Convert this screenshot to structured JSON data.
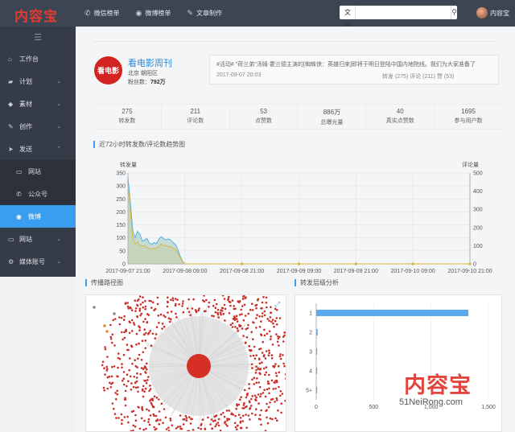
{
  "app": {
    "logo_text": "内容宝"
  },
  "topnav": [
    {
      "label": "微信榜单",
      "icon": "wechat-icon"
    },
    {
      "label": "微博榜单",
      "icon": "weibo-icon"
    },
    {
      "label": "文章制作",
      "icon": "pencil-icon"
    }
  ],
  "search": {
    "category": "文章",
    "placeholder": "",
    "button_icon": "search-icon"
  },
  "user": {
    "name": "内容宝"
  },
  "sidebar": {
    "items": [
      {
        "label": "工作台",
        "icon": "home-icon"
      },
      {
        "label": "计划",
        "icon": "folder-icon"
      },
      {
        "label": "素材",
        "icon": "cube-icon"
      },
      {
        "label": "创作",
        "icon": "pencil-icon"
      },
      {
        "label": "发送",
        "icon": "send-icon"
      },
      {
        "label": "网站",
        "icon": "monitor-icon"
      },
      {
        "label": "公众号",
        "icon": "wechat-icon"
      },
      {
        "label": "微博",
        "icon": "weibo-icon"
      },
      {
        "label": "网站",
        "icon": "monitor-icon"
      },
      {
        "label": "媒体账号",
        "icon": "gear-icon"
      }
    ]
  },
  "profile": {
    "logo_text": "看电影",
    "name": "看电影周刊",
    "location": "北京 朝阳区",
    "fans_label": "粉丝数：",
    "fans_value": "792万"
  },
  "post": {
    "text": "#活动# \"荷兰弟\"汤姆·霍兰德主演的[蜘蛛侠：英雄归来]即将于明日登陆中国内地院线。我们为大家准备了",
    "time": "2017-09-07 20:03",
    "stats": "转发 (275)  评论 (211)  赞 (53)"
  },
  "stats": [
    {
      "value": "275",
      "label": "转发数"
    },
    {
      "value": "211",
      "label": "评论数"
    },
    {
      "value": "53",
      "label": "点赞数"
    },
    {
      "value": "886万",
      "label": "总曝光量"
    },
    {
      "value": "40",
      "label": "真实点赞数"
    },
    {
      "value": "1695",
      "label": "参与用户数"
    }
  ],
  "sections": {
    "trend_title": "近72小时转发数/评论数趋势图",
    "spread_title": "传播路径图",
    "level_title": "转发层级分析"
  },
  "chart_data": [
    {
      "type": "area",
      "title": "近72小时转发数/评论数趋势图",
      "ylabel_left": "转发量",
      "ylabel_right": "评论量",
      "ylim_left": [
        0,
        350
      ],
      "yticks_left": [
        0,
        50,
        100,
        150,
        200,
        250,
        300,
        350
      ],
      "ylim_right": [
        0,
        500
      ],
      "yticks_right": [
        0,
        100,
        200,
        300,
        400,
        500
      ],
      "x_ticks": [
        "2017-09-07 21:00",
        "2017-09-08 09:00",
        "2017-09-08 21:00",
        "2017-09-09 09:00",
        "2017-09-09 21:00",
        "2017-09-10 09:00",
        "2017-09-10 21:00"
      ],
      "grid": true,
      "series": [
        {
          "color": "#4fb3e8",
          "axis": "left",
          "x": [
            0,
            0.3,
            1,
            1.5,
            2,
            2.5,
            3,
            3.5,
            4,
            4.5,
            5,
            5.5,
            6,
            6.5,
            7,
            7.5,
            8,
            8.5,
            9,
            9.5,
            10,
            10.5,
            11,
            11.5,
            12,
            13,
            14,
            16,
            18,
            24,
            30,
            36,
            42,
            48,
            54,
            60,
            66,
            72
          ],
          "values": [
            330,
            280,
            130,
            100,
            125,
            115,
            88,
            92,
            98,
            80,
            76,
            82,
            78,
            95,
            105,
            98,
            92,
            96,
            92,
            82,
            75,
            55,
            30,
            10,
            0,
            0,
            0,
            0,
            0,
            0,
            0,
            0,
            0,
            0,
            0,
            0,
            0,
            0
          ]
        },
        {
          "color": "#d9b641",
          "axis": "right",
          "x": [
            0,
            0.3,
            1,
            1.5,
            2,
            2.5,
            3,
            3.5,
            4,
            4.5,
            5,
            5.5,
            6,
            6.5,
            7,
            7.5,
            8,
            8.5,
            9,
            9.5,
            10,
            10.5,
            11,
            11.5,
            12,
            13,
            14,
            16,
            18,
            24,
            30,
            36,
            42,
            48,
            54,
            60,
            66,
            72
          ],
          "values": [
            420,
            370,
            140,
            110,
            120,
            100,
            100,
            100,
            90,
            85,
            80,
            85,
            85,
            95,
            110,
            100,
            100,
            95,
            95,
            85,
            80,
            60,
            35,
            12,
            0,
            0,
            0,
            0,
            0,
            0,
            0,
            0,
            0,
            0,
            0,
            0,
            0,
            0
          ]
        }
      ]
    },
    {
      "type": "bar",
      "orientation": "horizontal",
      "title": "转发层级分析",
      "categories": [
        "1",
        "2",
        "3",
        "4",
        "5+"
      ],
      "values": [
        1325,
        12,
        5,
        2,
        1
      ],
      "xticks": [
        0,
        500,
        1000,
        1500
      ],
      "xtick_labels": [
        "0",
        "500",
        "1,000",
        "1,500"
      ],
      "xlim": [
        0,
        1500
      ],
      "color": "#5aaaf0",
      "grid": true
    }
  ],
  "watermark": {
    "brand": "内容宝",
    "url": "51NeiRong.com"
  }
}
